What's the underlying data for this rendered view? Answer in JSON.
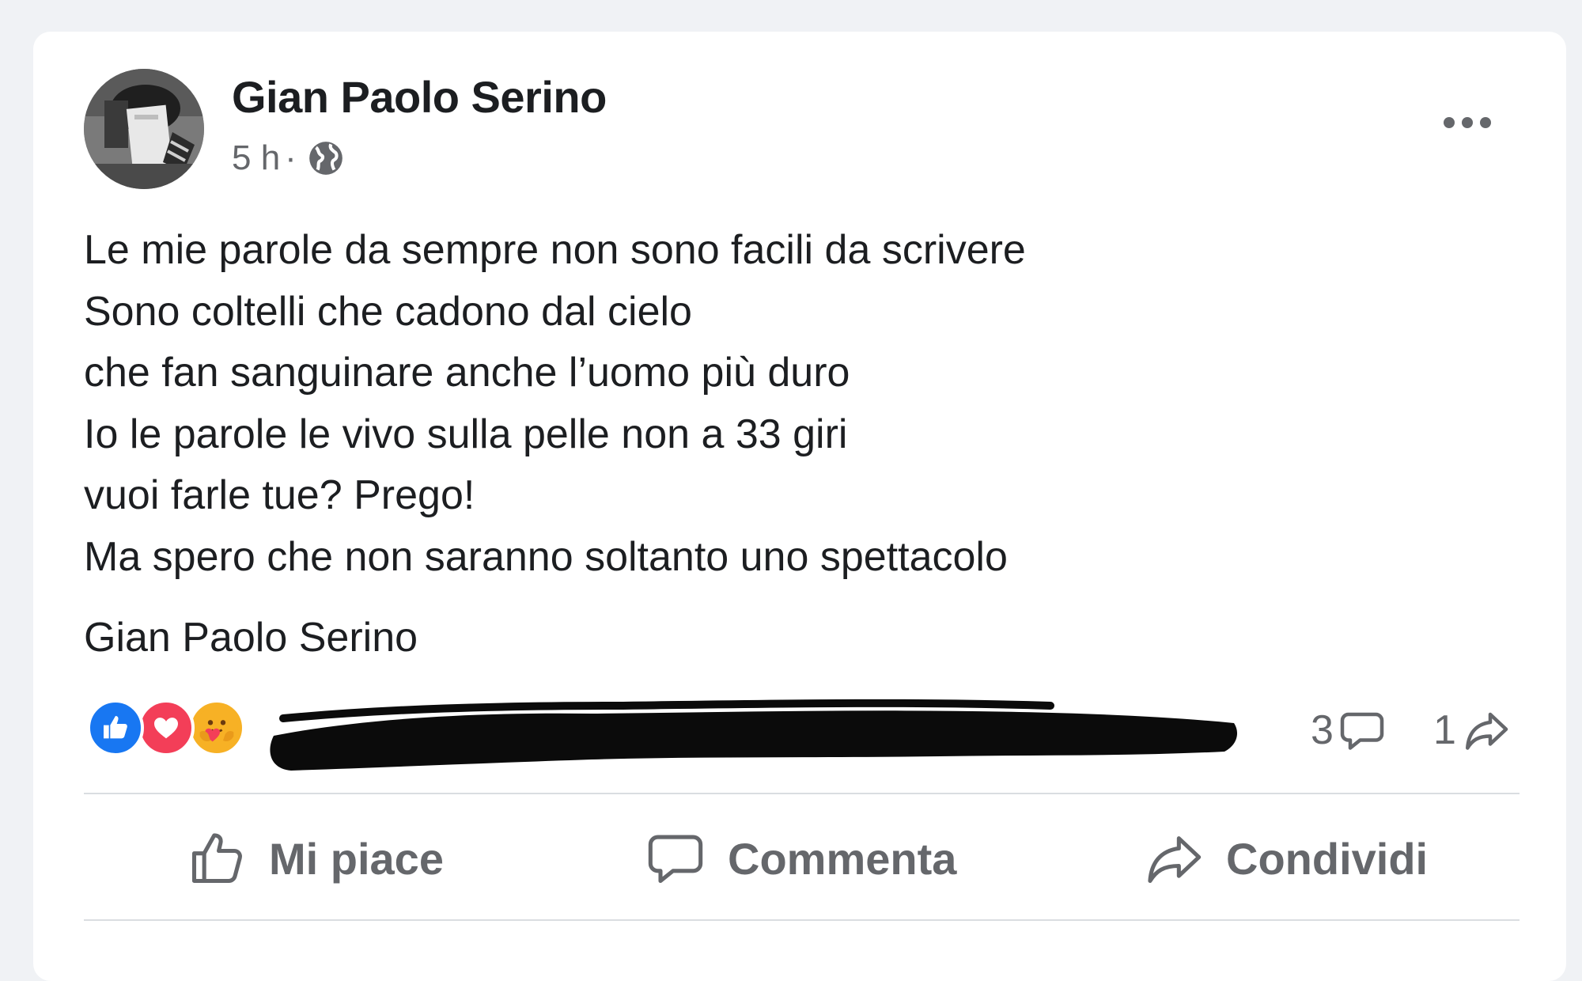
{
  "post": {
    "author": "Gian Paolo Serino",
    "time": "5 h",
    "separator": "·",
    "privacy_icon": "globe-icon",
    "more_icon": "more-options-icon",
    "lines": [
      "Le mie parole da sempre non sono facili da scrivere",
      "Sono coltelli che cadono dal cielo",
      "che fan sanguinare anche l’uomo più duro",
      "Io le parole le vivo sulla pelle non a 33 giri",
      "vuoi farle tue? Prego!",
      "Ma spero che non saranno soltanto uno spettacolo"
    ],
    "signature": "Gian Paolo Serino"
  },
  "reactions": {
    "icons": [
      "like-reaction-icon",
      "love-reaction-icon",
      "care-reaction-icon"
    ],
    "names": "[redacted]",
    "comments_count": "3",
    "shares_count": "1"
  },
  "actions": {
    "like_label": "Mi piace",
    "comment_label": "Commenta",
    "share_label": "Condividi"
  },
  "colors": {
    "background": "#f0f2f5",
    "card": "#ffffff",
    "text": "#1c1e21",
    "secondary_text": "#65676b",
    "like_blue": "#1877f2",
    "love_red": "#f33e58",
    "care_yellow": "#f7b125"
  }
}
